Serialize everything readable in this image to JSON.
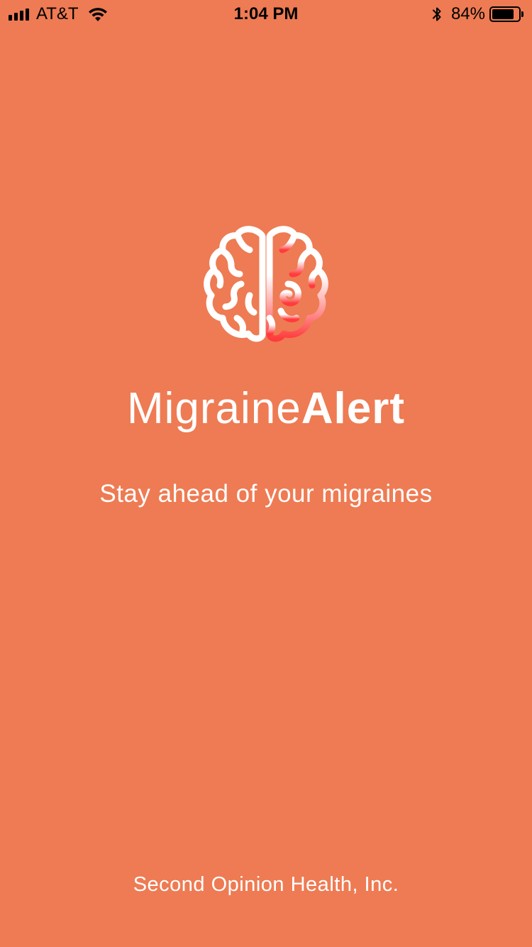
{
  "status_bar": {
    "carrier": "AT&T",
    "time": "1:04 PM",
    "battery_percent_text": "84%",
    "battery_level": 0.84,
    "signal_bars": 4,
    "icons": [
      "signal-icon",
      "wifi-icon",
      "bluetooth-icon",
      "battery-icon"
    ]
  },
  "splash": {
    "logo_icon": "brain-icon",
    "app_name_light": "Migraine",
    "app_name_bold": "Alert",
    "tagline": "Stay ahead of your migraines",
    "company": "Second Opinion Health, Inc."
  },
  "colors": {
    "background": "#EE7B53",
    "text": "#FFFFFF",
    "brain_accent": "#FF3B3B"
  }
}
